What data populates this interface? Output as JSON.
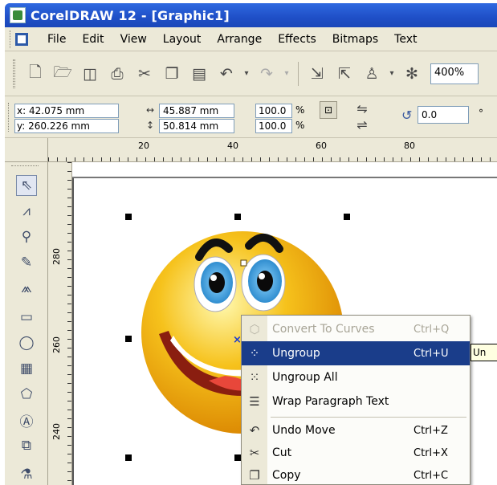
{
  "window": {
    "title": "CorelDRAW 12 - [Graphic1]"
  },
  "menubar": {
    "items": [
      "File",
      "Edit",
      "View",
      "Layout",
      "Arrange",
      "Effects",
      "Bitmaps",
      "Text"
    ]
  },
  "standard_toolbar": {
    "zoom_value": "400%"
  },
  "property_bar": {
    "x_label": "x:",
    "x_value": "42.075 mm",
    "y_label": "y:",
    "y_value": "260.226 mm",
    "width_value": "45.887 mm",
    "height_value": "50.814 mm",
    "scale_x": "100.0",
    "scale_y": "100.0",
    "percent_sign": "%",
    "rotation_value": "0.0",
    "degree_sign": "°"
  },
  "rulers": {
    "top_labels": [
      "20",
      "40",
      "60",
      "80"
    ],
    "left_labels": [
      "280",
      "260",
      "240"
    ]
  },
  "context_menu": {
    "items": [
      {
        "label": "Convert To Curves",
        "shortcut": "Ctrl+Q",
        "icon": "convert-curves-icon",
        "state": "disabled"
      },
      {
        "label": "Ungroup",
        "shortcut": "Ctrl+U",
        "icon": "ungroup-icon",
        "state": "selected"
      },
      {
        "label": "Ungroup All",
        "shortcut": "",
        "icon": "ungroup-all-icon",
        "state": "normal"
      },
      {
        "label": "Wrap Paragraph Text",
        "shortcut": "",
        "icon": "wrap-text-icon",
        "state": "normal"
      },
      {
        "label": "Undo Move",
        "shortcut": "Ctrl+Z",
        "icon": "undo-icon",
        "state": "normal"
      },
      {
        "label": "Cut",
        "shortcut": "Ctrl+X",
        "icon": "scissors-icon",
        "state": "normal"
      },
      {
        "label": "Copy",
        "shortcut": "Ctrl+C",
        "icon": "copy-icon",
        "state": "normal"
      }
    ]
  },
  "tooltip": {
    "text": "Un"
  },
  "colors": {
    "titlebar": "#1f4fc7",
    "chrome": "#ece9d8",
    "menu_highlight": "#1a3d8a",
    "smiley_yellow": "#f6c21c"
  }
}
